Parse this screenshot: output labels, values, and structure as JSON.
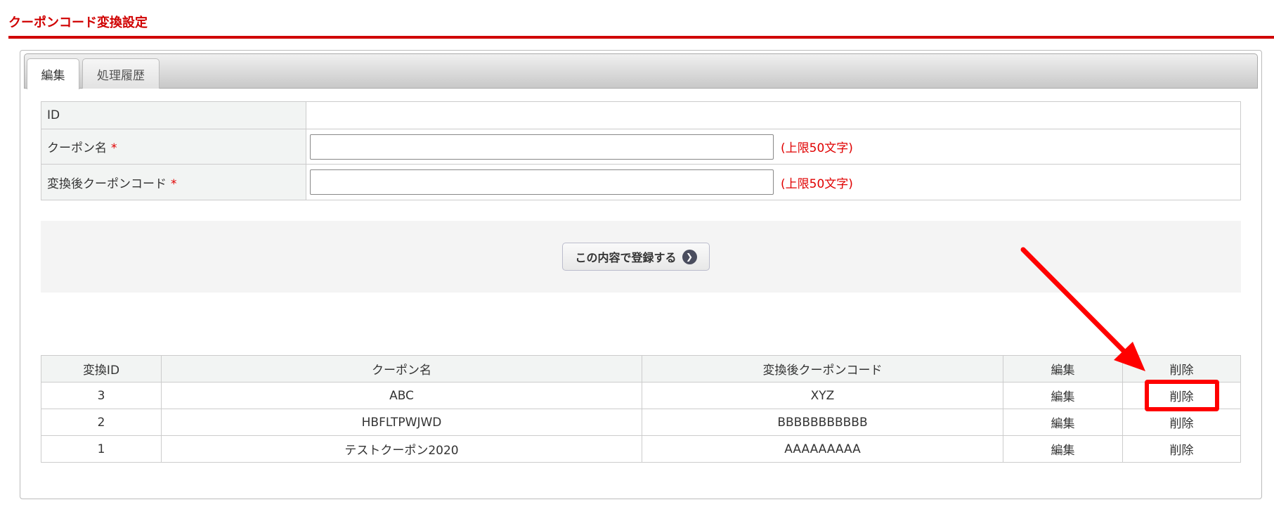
{
  "page": {
    "title": "クーポンコード変換設定"
  },
  "tabs": [
    {
      "label": "編集"
    },
    {
      "label": "処理履歴"
    }
  ],
  "form": {
    "id_label": "ID",
    "id_value": "",
    "coupon_name_label": "クーポン名",
    "coupon_name_value": "",
    "coupon_name_limit": "(上限50文字)",
    "converted_code_label": "変換後クーポンコード",
    "converted_code_value": "",
    "converted_code_limit": "(上限50文字)",
    "required_mark": "*",
    "submit_label": "この内容で登録する"
  },
  "list": {
    "headers": [
      "変換ID",
      "クーポン名",
      "変換後クーポンコード",
      "編集",
      "削除"
    ],
    "rows": [
      {
        "id": "3",
        "name": "ABC",
        "code": "XYZ",
        "edit": "編集",
        "delete": "削除"
      },
      {
        "id": "2",
        "name": "HBFLTPWJWD",
        "code": "BBBBBBBBBBB",
        "edit": "編集",
        "delete": "削除"
      },
      {
        "id": "1",
        "name": "テストクーポン2020",
        "code": "AAAAAAAAA",
        "edit": "編集",
        "delete": "削除"
      }
    ]
  },
  "colors": {
    "accent": "#d00000",
    "annotation": "#ff0000"
  }
}
